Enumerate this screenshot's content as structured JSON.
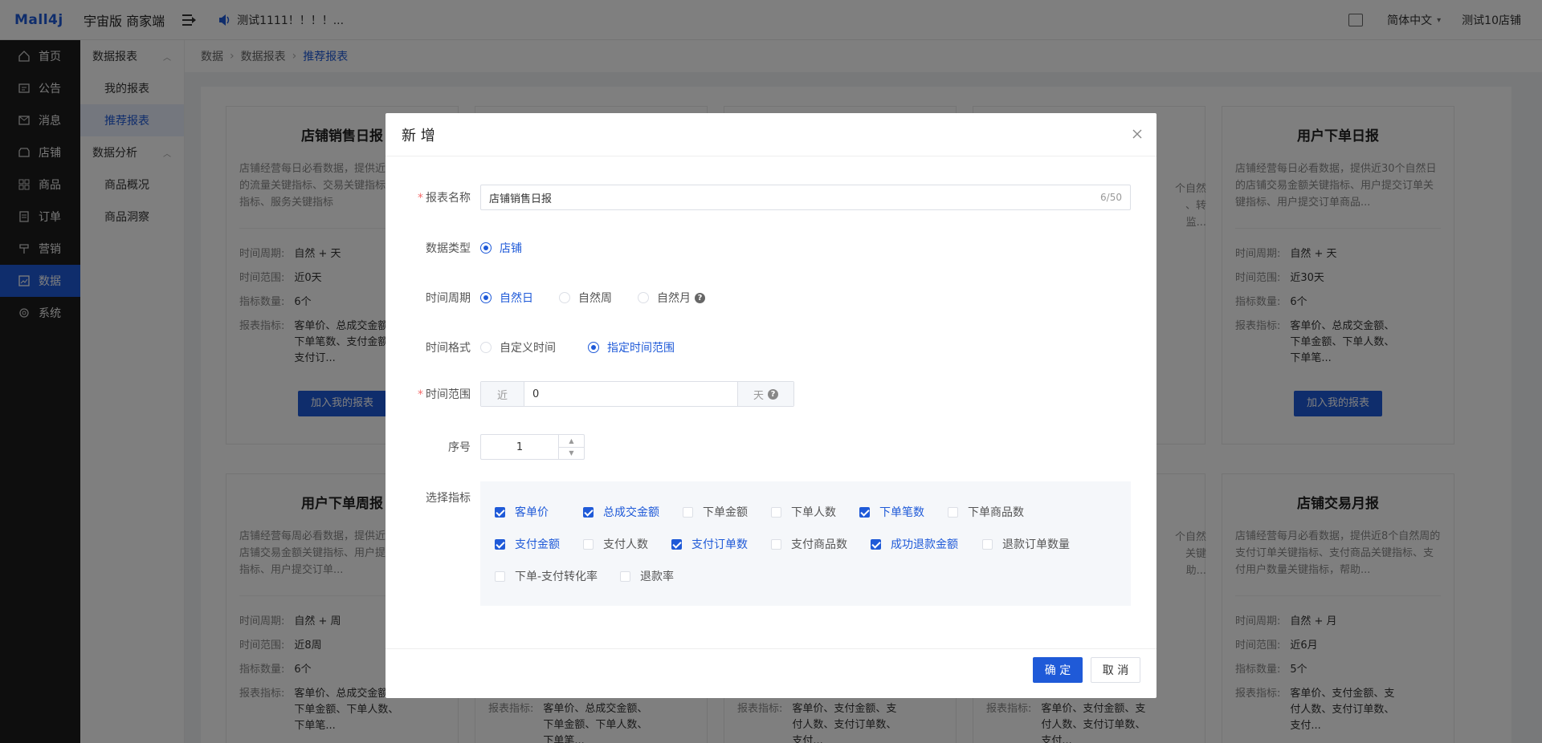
{
  "topbar": {
    "logo": "Mall4j",
    "brand": "宇宙版 商家端",
    "notice": "测试1111！！！！...",
    "language": "简体中文",
    "shop": "测试10店铺"
  },
  "leftnav": [
    {
      "label": "首页",
      "icon": "home-icon"
    },
    {
      "label": "公告",
      "icon": "notice-icon"
    },
    {
      "label": "消息",
      "icon": "mail-icon"
    },
    {
      "label": "店铺",
      "icon": "shop-icon"
    },
    {
      "label": "商品",
      "icon": "product-icon"
    },
    {
      "label": "订单",
      "icon": "order-icon"
    },
    {
      "label": "营销",
      "icon": "marketing-icon"
    },
    {
      "label": "数据",
      "icon": "data-icon"
    },
    {
      "label": "系统",
      "icon": "gear-icon"
    }
  ],
  "subnav": {
    "group1": "数据报表",
    "item1": "我的报表",
    "item2": "推荐报表",
    "group2": "数据分析",
    "item3": "商品概况",
    "item4": "商品洞察"
  },
  "breadcrumb": [
    "数据",
    "数据报表",
    "推荐报表"
  ],
  "cards": {
    "labels": {
      "period": "时间周期:",
      "range": "时间范围:",
      "count": "指标数量:",
      "metrics": "报表指标:",
      "button": "加入我的报表"
    },
    "c1": {
      "title": "店铺销售日报",
      "desc": "店铺经营每日必看数据，提供近30个自然日的流量关键指标、交易关键指标、转化关键指标、服务关键指标",
      "period": "自然 + 天",
      "range": "近0天",
      "count": "6个",
      "metrics": "客单价、总成交金额、下单笔数、支付金额、支付订..."
    },
    "c2": {
      "title": "用户下单日报",
      "desc": "店铺经营每日必看数据，提供近30个自然日的店铺交易金额关键指标、用户提交订单关键指标、用户提交订单商品...",
      "period": "自然 + 天",
      "range": "近30天",
      "count": "6个",
      "metrics": "客单价、总成交金额、下单金额、下单人数、下单笔..."
    },
    "c3": {
      "title": "用户下单周报",
      "desc": "店铺经营每周必看数据，提供近8个自然周的店铺交易金额关键指标、用户提交订单关键指标、用户提交订单...",
      "period": "自然 + 周",
      "range": "近8周",
      "count": "6个",
      "metrics": "客单价、总成交金额、下单金额、下单人数、下单笔..."
    },
    "c4": {
      "title": "店铺交易月报",
      "desc": "店铺经营每月必看数据，提供近8个自然周的支付订单关键指标、支付商品关键指标、支付用户数量关键指标，帮助...",
      "period": "自然 + 月",
      "range": "近6月",
      "count": "5个",
      "metrics": "客单价、支付金额、支付人数、支付订单数、支付..."
    },
    "partial": {
      "metrics_label": "报表指标:",
      "metrics_a": "客单价、总成交金额、下单金额、下单人数、下单笔...",
      "metrics_b": "客单价、支付金额、支付人数、支付订单数、支付...",
      "frag1": "个自然",
      "frag2": "、转",
      "frag3": "监...",
      "frag4": "个自然",
      "frag5": "关键",
      "frag6": "助..."
    }
  },
  "modal": {
    "title": "新 增",
    "name_label": "报表名称",
    "name_value": "店铺销售日报",
    "name_count": "6/50",
    "type_label": "数据类型",
    "type_option": "店铺",
    "period_label": "时间周期",
    "period_options": [
      "自然日",
      "自然周",
      "自然月"
    ],
    "format_label": "时间格式",
    "format_options": [
      "自定义时间",
      "指定时间范围"
    ],
    "range_label": "时间范围",
    "range_prefix": "近",
    "range_value": "0",
    "range_suffix": "天",
    "order_label": "序号",
    "order_value": "1",
    "metrics_label": "选择指标",
    "metrics": [
      {
        "label": "客单价",
        "checked": true
      },
      {
        "label": "总成交金额",
        "checked": true
      },
      {
        "label": "下单金额",
        "checked": false
      },
      {
        "label": "下单人数",
        "checked": false
      },
      {
        "label": "下单笔数",
        "checked": true
      },
      {
        "label": "下单商品数",
        "checked": false
      },
      {
        "label": "支付金额",
        "checked": true
      },
      {
        "label": "支付人数",
        "checked": false
      },
      {
        "label": "支付订单数",
        "checked": true
      },
      {
        "label": "支付商品数",
        "checked": false
      },
      {
        "label": "成功退款金额",
        "checked": true
      },
      {
        "label": "退款订单数量",
        "checked": false
      },
      {
        "label": "下单-支付转化率",
        "checked": false
      },
      {
        "label": "退款率",
        "checked": false
      }
    ],
    "confirm": "确 定",
    "cancel": "取 消"
  },
  "colors": {
    "primary": "#1f5ad8",
    "sidebar": "#1d1d1d",
    "required": "#f56c6c"
  }
}
